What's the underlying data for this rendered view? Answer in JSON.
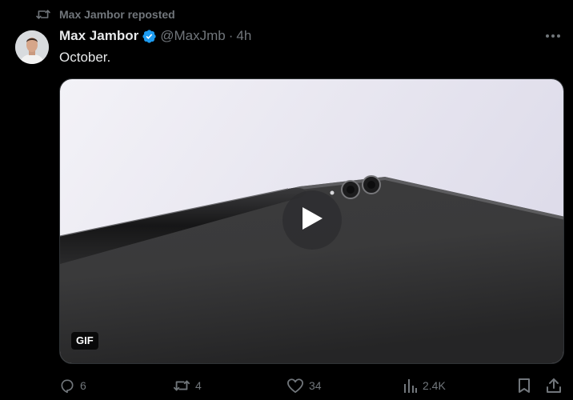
{
  "repost": {
    "label": "Max Jambor reposted"
  },
  "author": {
    "display_name": "Max Jambor",
    "handle": "@MaxJmb",
    "separator": "·",
    "time": "4h"
  },
  "tweet": {
    "text": "October."
  },
  "media": {
    "badge": "GIF"
  },
  "actions": {
    "replies": "6",
    "reposts": "4",
    "likes": "34",
    "views": "2.4K"
  },
  "colors": {
    "background": "#000000",
    "text_primary": "#e7e9ea",
    "text_secondary": "#71767b",
    "verified_blue": "#1d9bf0"
  },
  "icons": {
    "repost_line": "repost-icon",
    "verified": "verified-badge-icon",
    "more": "more-options-icon",
    "play": "play-icon",
    "reply": "reply-icon",
    "repost": "repost-icon",
    "like": "heart-icon",
    "views": "views-chart-icon",
    "bookmark": "bookmark-icon",
    "share": "share-icon"
  }
}
